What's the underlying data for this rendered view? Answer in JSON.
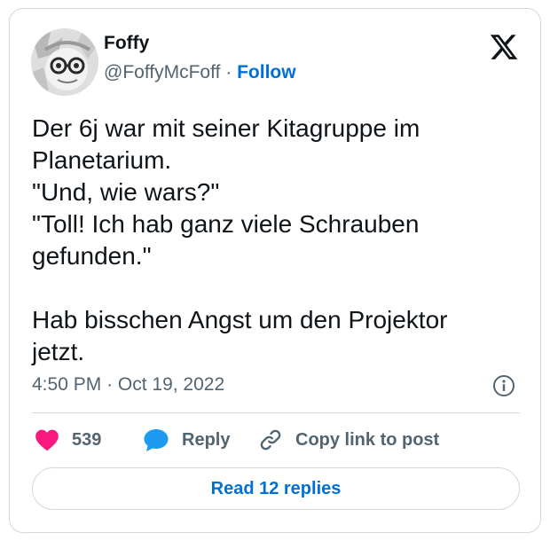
{
  "author": {
    "display_name": "Foffy",
    "handle": "@FoffyMcFoff",
    "separator": "·",
    "follow_label": "Follow"
  },
  "tweet": {
    "text": "Der 6j war mit seiner Kitagruppe im\nPlanetarium.\n\"Und, wie wars?\"\n\"Toll! Ich hab ganz viele Schrauben\ngefunden.\"\n\nHab bisschen Angst um den Projektor\njetzt.",
    "time": "4:50 PM",
    "date_separator": "·",
    "date": "Oct 19, 2022"
  },
  "actions": {
    "like_count": "539",
    "reply_label": "Reply",
    "copy_label": "Copy link to post"
  },
  "read_replies_label": "Read 12 replies",
  "icons": {
    "platform": "x-logo-icon",
    "info": "info-icon",
    "like": "heart-icon",
    "reply": "speech-bubble-icon",
    "copy": "link-icon"
  },
  "colors": {
    "text": "#0f1419",
    "secondary": "#536471",
    "link": "#006fd6",
    "like": "#f91880",
    "reply": "#1d9bf0",
    "border": "#cfd9de"
  }
}
